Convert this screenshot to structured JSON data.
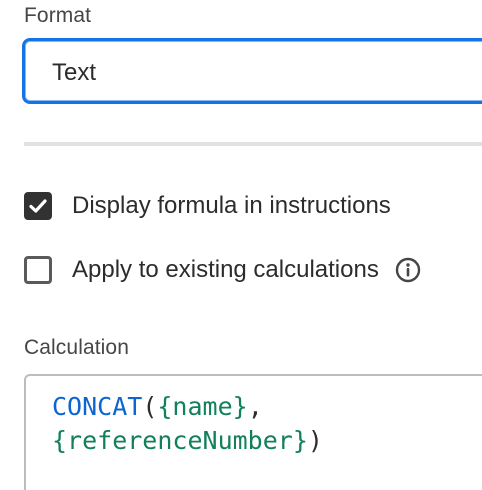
{
  "format": {
    "label": "Format",
    "value": "Text"
  },
  "options": {
    "display_formula": {
      "label": "Display formula in instructions",
      "checked": true
    },
    "apply_existing": {
      "label": "Apply to existing calculations",
      "checked": false,
      "icon": "info-icon"
    }
  },
  "calculation": {
    "label": "Calculation",
    "function": "CONCAT",
    "open_paren": "(",
    "arg1": "{name}",
    "separator": ",",
    "arg2": "{referenceNumber}",
    "close_paren": ")"
  },
  "colors": {
    "accent": "#1473e6",
    "function": "#0d66d0",
    "reference": "#12805c"
  }
}
